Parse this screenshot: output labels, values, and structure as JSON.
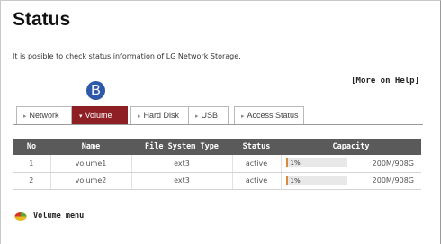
{
  "page": {
    "title": "Status",
    "description": "It is posible to check status information of LG Network Storage.",
    "help_link": "[More on Help]"
  },
  "marker": {
    "label": "B",
    "color": "#2e58a8"
  },
  "tabs": [
    {
      "label": "Network",
      "active": false
    },
    {
      "label": "Volume",
      "active": true
    },
    {
      "label": "Hard Disk",
      "active": false
    },
    {
      "label": "USB",
      "active": false
    },
    {
      "label": "Access Status",
      "active": false
    }
  ],
  "table": {
    "headers": [
      "No",
      "Name",
      "File System Type",
      "Status",
      "Capacity"
    ],
    "rows": [
      {
        "no": "1",
        "name": "volume1",
        "fs": "ext3",
        "status": "active",
        "usage_label": "1%",
        "usage_fraction": 0.01,
        "capacity": "200M/908G"
      },
      {
        "no": "2",
        "name": "volume2",
        "fs": "ext3",
        "status": "active",
        "usage_label": "1%",
        "usage_fraction": 0.01,
        "capacity": "200M/908G"
      }
    ]
  },
  "volume_menu": {
    "label": "Volume menu",
    "icon": "pie-chart-icon"
  },
  "colors": {
    "active_tab": "#8e1f24",
    "table_header": "#5a5a5a",
    "usage_bar": "#d98b3c"
  }
}
